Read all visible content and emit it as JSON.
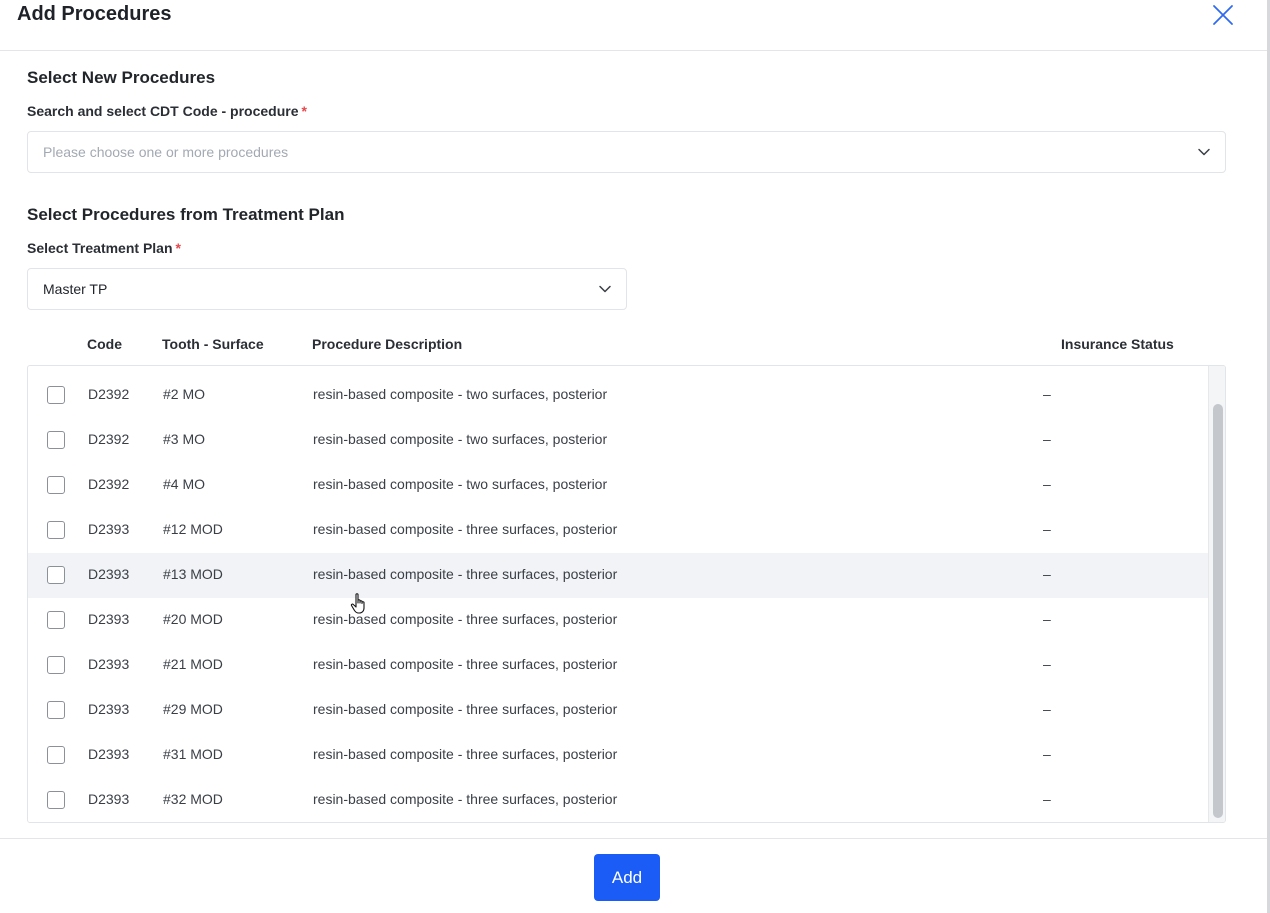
{
  "modal": {
    "title": "Add Procedures",
    "close_icon": "close-icon"
  },
  "new_procedures": {
    "section_title": "Select New Procedures",
    "label": "Search and select CDT Code - procedure",
    "required_mark": "*",
    "placeholder": "Please choose one or more procedures"
  },
  "treatment_plan": {
    "section_title": "Select Procedures from Treatment Plan",
    "label": "Select Treatment Plan",
    "required_mark": "*",
    "selected": "Master TP"
  },
  "table": {
    "columns": [
      "Code",
      "Tooth - Surface",
      "Procedure Description",
      "Insurance Status"
    ],
    "rows": [
      {
        "code": "D2392",
        "tooth": "#2 MO",
        "description": "resin-based composite - two surfaces, posterior",
        "insurance": "–",
        "checked": false
      },
      {
        "code": "D2392",
        "tooth": "#3 MO",
        "description": "resin-based composite - two surfaces, posterior",
        "insurance": "–",
        "checked": false
      },
      {
        "code": "D2392",
        "tooth": "#4 MO",
        "description": "resin-based composite - two surfaces, posterior",
        "insurance": "–",
        "checked": false
      },
      {
        "code": "D2393",
        "tooth": "#12 MOD",
        "description": "resin-based composite - three surfaces, posterior",
        "insurance": "–",
        "checked": false
      },
      {
        "code": "D2393",
        "tooth": "#13 MOD",
        "description": "resin-based composite - three surfaces, posterior",
        "insurance": "–",
        "checked": false,
        "hovered": true
      },
      {
        "code": "D2393",
        "tooth": "#20 MOD",
        "description": "resin-based composite - three surfaces, posterior",
        "insurance": "–",
        "checked": false
      },
      {
        "code": "D2393",
        "tooth": "#21 MOD",
        "description": "resin-based composite - three surfaces, posterior",
        "insurance": "–",
        "checked": false
      },
      {
        "code": "D2393",
        "tooth": "#29 MOD",
        "description": "resin-based composite - three surfaces, posterior",
        "insurance": "–",
        "checked": false
      },
      {
        "code": "D2393",
        "tooth": "#31 MOD",
        "description": "resin-based composite - three surfaces, posterior",
        "insurance": "–",
        "checked": false
      },
      {
        "code": "D2393",
        "tooth": "#32 MOD",
        "description": "resin-based composite - three surfaces, posterior",
        "insurance": "–",
        "checked": false
      }
    ]
  },
  "footer": {
    "add_label": "Add"
  },
  "colors": {
    "primary": "#1a5cf5",
    "required": "#e5484d",
    "close_icon": "#2f6bef"
  }
}
